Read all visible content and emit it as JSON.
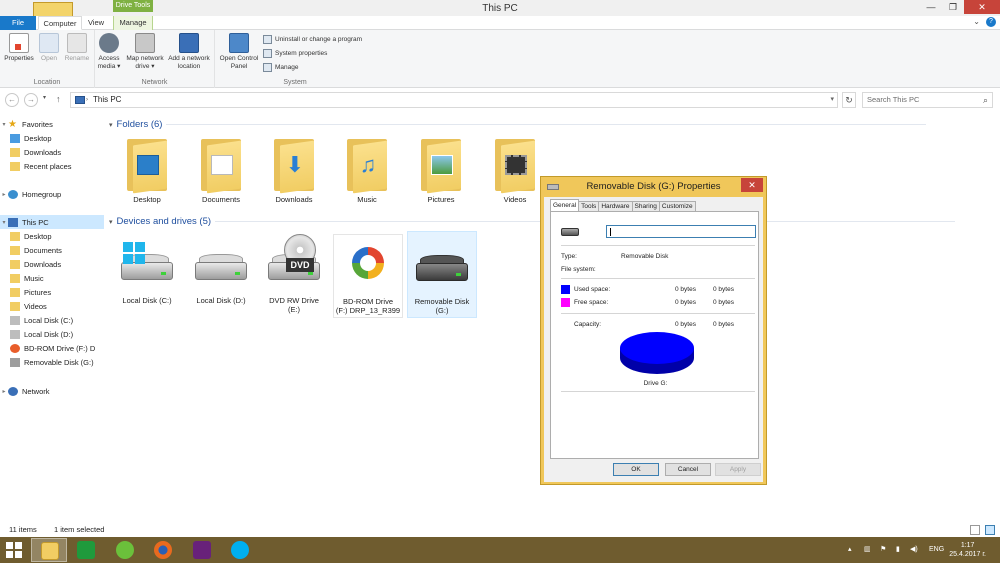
{
  "window": {
    "title": "This PC",
    "contextual_tab": "Drive Tools",
    "tabs": {
      "file": "File",
      "computer": "Computer",
      "view": "View",
      "manage": "Manage"
    }
  },
  "ribbon": {
    "location": {
      "label": "Location",
      "properties": "Properties",
      "open": "Open",
      "rename": "Rename"
    },
    "network": {
      "label": "Network",
      "access_media_1": "Access",
      "access_media_2": "media ▾",
      "map_drive_1": "Map network",
      "map_drive_2": "drive ▾",
      "add_location_1": "Add a network",
      "add_location_2": "location"
    },
    "system": {
      "label": "System",
      "control_panel_1": "Open Control",
      "control_panel_2": "Panel",
      "uninstall": "Uninstall or change a program",
      "system_properties": "System properties",
      "manage": "Manage"
    }
  },
  "address": {
    "path": "This PC",
    "search_placeholder": "Search This PC"
  },
  "nav": {
    "favorites": "Favorites",
    "desktop": "Desktop",
    "downloads": "Downloads",
    "recent": "Recent places",
    "homegroup": "Homegroup",
    "this_pc": "This PC",
    "pc_desktop": "Desktop",
    "pc_documents": "Documents",
    "pc_downloads": "Downloads",
    "pc_music": "Music",
    "pc_pictures": "Pictures",
    "pc_videos": "Videos",
    "local_c": "Local Disk (C:)",
    "local_d": "Local Disk (D:)",
    "bd_rom": "BD-ROM Drive (F:) D",
    "removable_g": "Removable Disk (G:)",
    "network": "Network"
  },
  "content": {
    "folders_header": "Folders (6)",
    "devices_header": "Devices and drives (5)",
    "folders": [
      "Desktop",
      "Documents",
      "Downloads",
      "Music",
      "Pictures",
      "Videos"
    ],
    "drives": {
      "c": "Local Disk (C:)",
      "d": "Local Disk (D:)",
      "e_1": "DVD RW Drive",
      "e_2": "(E:)",
      "f_1": "BD-ROM Drive",
      "f_2": "(F:) DRP_13_R399",
      "g_1": "Removable Disk",
      "g_2": "(G:)",
      "dvd_label": "DVD"
    }
  },
  "status": {
    "items": "11 items",
    "selected": "1 item selected"
  },
  "dialog": {
    "title": "Removable Disk (G:) Properties",
    "close": "✕",
    "tabs": [
      "General",
      "Tools",
      "Hardware",
      "Sharing",
      "Customize"
    ],
    "name_value": "",
    "type_label": "Type:",
    "type_value": "Removable Disk",
    "fs_label": "File system:",
    "used_label": "Used space:",
    "used_bytes": "0 bytes",
    "used_bytes2": "0 bytes",
    "free_label": "Free space:",
    "free_bytes": "0 bytes",
    "free_bytes2": "0 bytes",
    "cap_label": "Capacity:",
    "cap_bytes": "0 bytes",
    "cap_bytes2": "0 bytes",
    "drive_label": "Drive G:",
    "ok": "OK",
    "cancel": "Cancel",
    "apply": "Apply",
    "colors": {
      "used": "#0000ff",
      "free": "#ff00ff"
    }
  },
  "taskbar": {
    "lang": "ENG",
    "time": "1:17",
    "date": "25.4.2017 г."
  }
}
